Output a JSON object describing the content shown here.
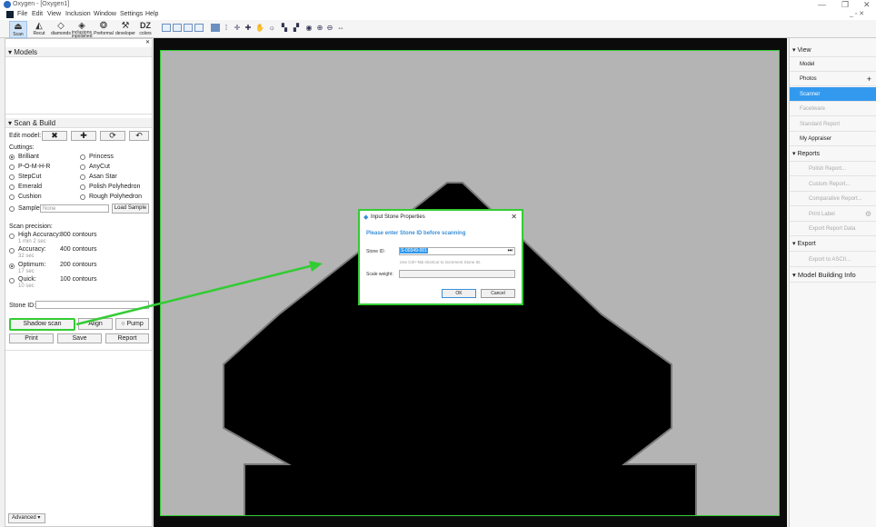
{
  "window": {
    "title": "Oxygen - [Oxygen1]",
    "min": "—",
    "restore": "❐",
    "close": "✕",
    "inner_controls": "_ ▫ ✕"
  },
  "menu": [
    "File",
    "Edit",
    "View",
    "Inclusion",
    "Window",
    "Settings",
    "Help"
  ],
  "toolbar": {
    "buttons": [
      {
        "label": "Scan",
        "icon": "⏏"
      },
      {
        "label": "Recut",
        "icon": "◭"
      },
      {
        "label": "diamonds",
        "icon": "◇"
      },
      {
        "label": "inclusions inpolished",
        "icon": "◈"
      },
      {
        "label": "Preformal",
        "icon": "❂"
      },
      {
        "label": "developer",
        "icon": "⚒"
      },
      {
        "label": "colors",
        "icon": "DZ"
      }
    ]
  },
  "models": {
    "title": "Models"
  },
  "scan_build": {
    "title": "Scan & Build",
    "edit_model": "Edit model:",
    "cuttings_label": "Cuttings:",
    "cuttings": [
      {
        "left": "Brilliant",
        "right": "Princess"
      },
      {
        "left": "P-O-M-H-R",
        "right": "AnyCut"
      },
      {
        "left": "StepCut",
        "right": "Asan Star"
      },
      {
        "left": "Emerald",
        "right": "Polish Polyhedron"
      },
      {
        "left": "Cushion",
        "right": "Rough Polyhedron"
      }
    ],
    "sample_label": "Sample:",
    "sample_placeholder": "None",
    "load_sample": "Load Sample",
    "precision_label": "Scan precision:",
    "precision": [
      {
        "name": "High Accuracy:",
        "contours": "800 contours",
        "time": "1 min 2 sec"
      },
      {
        "name": "Accuracy:",
        "contours": "400 contours",
        "time": "32 sec"
      },
      {
        "name": "Optimum:",
        "contours": "200 contours",
        "time": "17 sec"
      },
      {
        "name": "Quick:",
        "contours": "100 contours",
        "time": "10 sec"
      }
    ],
    "stone_id_label": "Stone ID:",
    "shadow_scan": "Shadow scan",
    "align": "Align",
    "pump": "Pump",
    "print": "Print",
    "save": "Save",
    "report": "Report",
    "advanced": "Advanced"
  },
  "right_panel": {
    "view_header": "View",
    "items": [
      "Model",
      "Photos",
      "Scanner",
      "Facetware",
      "Standard Report",
      "My Appraiser"
    ],
    "reports_header": "Reports",
    "reports": [
      "Polish Report...",
      "Custom Report...",
      "Comparative Report...",
      "Print Label",
      "Export Report Data"
    ],
    "export_header": "Export",
    "export_items": [
      "Export to ASCII..."
    ],
    "model_info": "Model Building Info"
  },
  "dialog": {
    "title": "Input Stone Properties",
    "message": "Please enter Stone ID before scanning",
    "stone_id_label": "Stone ID:",
    "stone_id_value": "S-00349-001",
    "hint": "Use Ctrl+Tab shortcut to increment Stone ID.",
    "scale_label": "Scale weight:",
    "ok": "OK",
    "cancel": "Cancel"
  },
  "colors": {
    "highlight": "#33cc33",
    "selected": "#3399ee"
  }
}
